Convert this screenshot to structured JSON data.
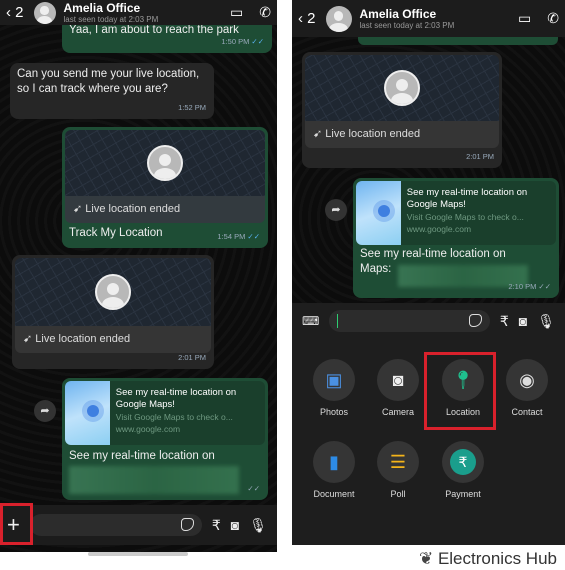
{
  "header": {
    "back_count": "2",
    "contact_name": "Amelia Office",
    "last_seen": "last seen today at 2:03 PM"
  },
  "left": {
    "messages": [
      {
        "text": "Yaa, I am about to reach the park",
        "time": "1:50 PM"
      },
      {
        "text": "Can you send me your live location, so I can track where you are?",
        "time": "1:52 PM"
      },
      {
        "status": "Live location ended",
        "text": "Track My Location",
        "time": "1:54 PM"
      },
      {
        "status": "Live location ended",
        "time": "2:01 PM"
      },
      {
        "link_title": "See my real-time location on Google Maps!",
        "link_desc": "Visit Google Maps to check o...",
        "link_domain": "www.google.com",
        "text": "See my real-time location on"
      }
    ],
    "plus_label": "+"
  },
  "right": {
    "messages": [
      {
        "status": "Live location ended",
        "time": "2:01 PM"
      },
      {
        "link_title": "See my real-time location on Google Maps!",
        "link_desc": "Visit Google Maps to check o...",
        "link_domain": "www.google.com",
        "text": "See my real-time location on Maps:",
        "time": "2:10 PM"
      }
    ],
    "attachments": [
      "Photos",
      "Camera",
      "Location",
      "Contact",
      "Document",
      "Poll",
      "Payment"
    ]
  },
  "highlight_color": "#d9212c",
  "watermark": "Electronics Hub"
}
